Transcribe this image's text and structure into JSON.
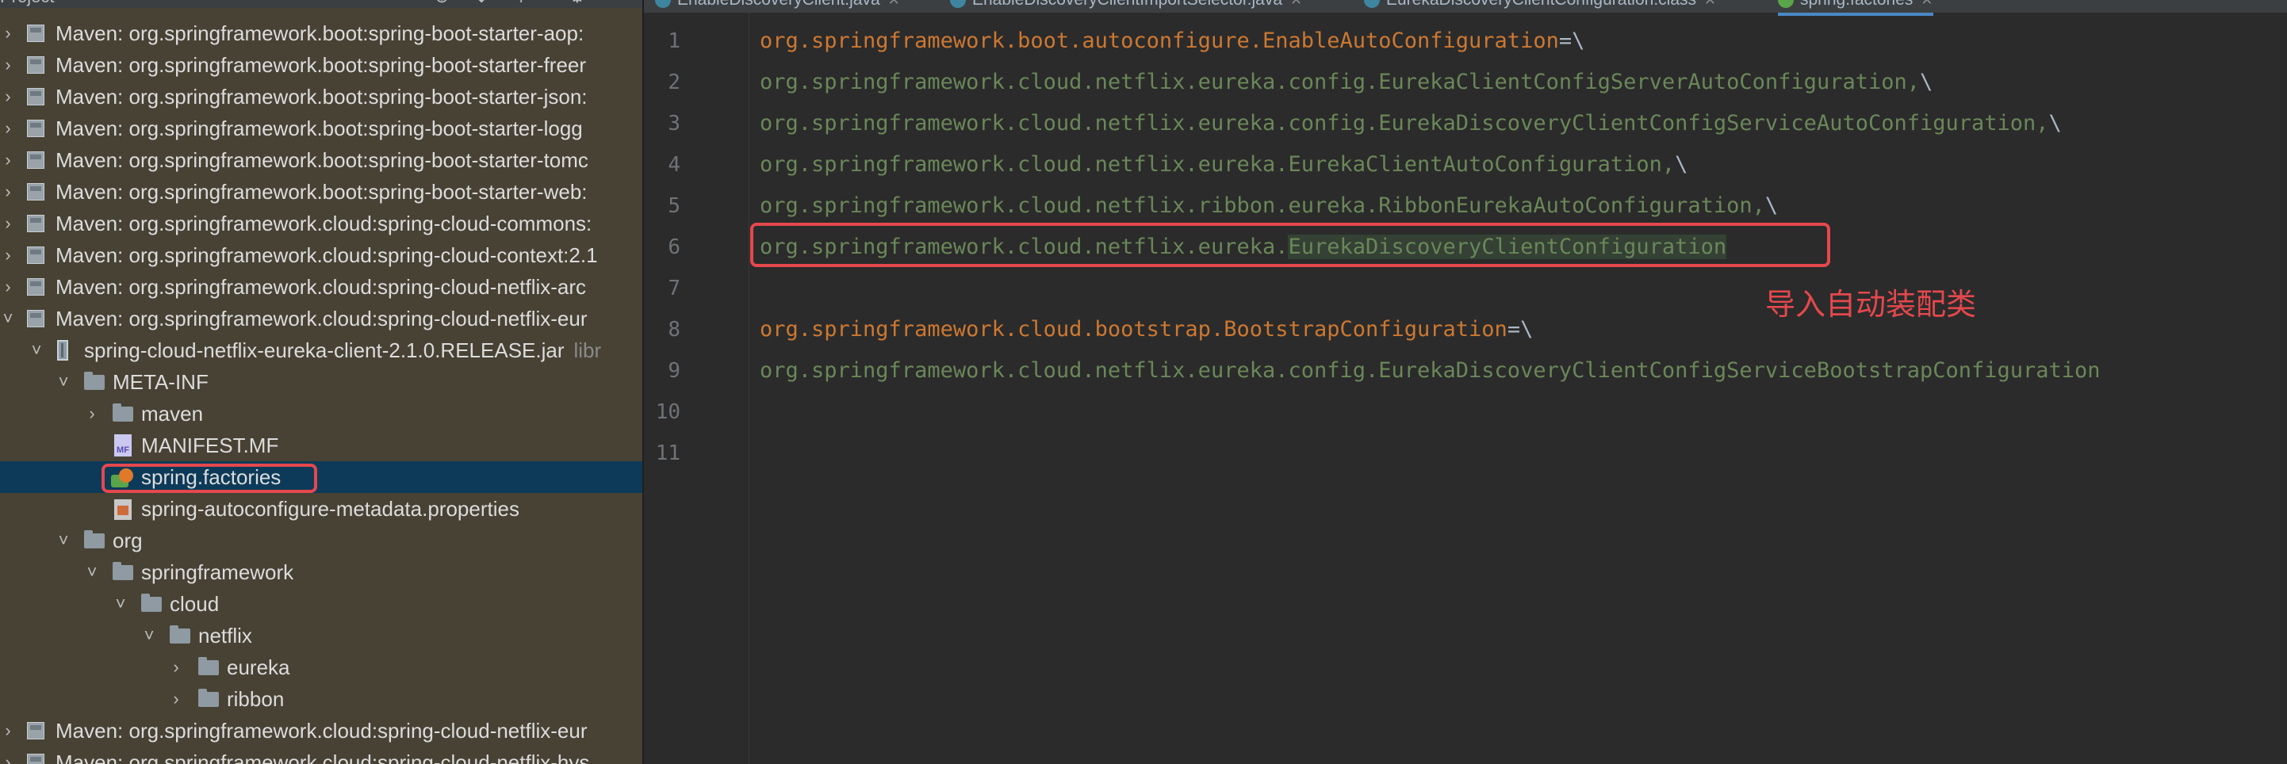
{
  "project_panel": {
    "title": "Project",
    "tree": [
      {
        "label": "Maven: org.springframework.boot:spring-boot-starter-aop:"
      },
      {
        "label": "Maven: org.springframework.boot:spring-boot-starter-freer"
      },
      {
        "label": "Maven: org.springframework.boot:spring-boot-starter-json:"
      },
      {
        "label": "Maven: org.springframework.boot:spring-boot-starter-logg"
      },
      {
        "label": "Maven: org.springframework.boot:spring-boot-starter-tomc"
      },
      {
        "label": "Maven: org.springframework.boot:spring-boot-starter-web:"
      },
      {
        "label": "Maven: org.springframework.cloud:spring-cloud-commons:"
      },
      {
        "label": "Maven: org.springframework.cloud:spring-cloud-context:2.1"
      },
      {
        "label": "Maven: org.springframework.cloud:spring-cloud-netflix-arc"
      },
      {
        "label": "Maven: org.springframework.cloud:spring-cloud-netflix-eur"
      },
      {
        "label": "spring-cloud-netflix-eureka-client-2.1.0.RELEASE.jar",
        "suffix": "libr"
      },
      {
        "label": "META-INF"
      },
      {
        "label": "maven"
      },
      {
        "label": "MANIFEST.MF"
      },
      {
        "label": "spring.factories"
      },
      {
        "label": "spring-autoconfigure-metadata.properties"
      },
      {
        "label": "org"
      },
      {
        "label": "springframework"
      },
      {
        "label": "cloud"
      },
      {
        "label": "netflix"
      },
      {
        "label": "eureka"
      },
      {
        "label": "ribbon"
      },
      {
        "label": "Maven: org.springframework.cloud:spring-cloud-netflix-eur"
      },
      {
        "label": "Maven: org.springframework.cloud:spring-cloud-netflix-hys"
      }
    ]
  },
  "tabs": [
    {
      "label": "EnableDiscoveryClient.java"
    },
    {
      "label": "EnableDiscoveryClientImportSelector.java"
    },
    {
      "label": "EurekaDiscoveryClientConfiguration.class"
    },
    {
      "label": "spring.factories"
    }
  ],
  "editor": {
    "line_numbers": [
      "1",
      "2",
      "3",
      "4",
      "5",
      "6",
      "7",
      "8",
      "9",
      "10",
      "11"
    ],
    "lines": [
      {
        "key": "org.springframework.boot.autoconfigure.EnableAutoConfiguration",
        "sep": "=\\"
      },
      {
        "value": "org.springframework.cloud.netflix.eureka.config.EurekaClientConfigServerAutoConfiguration,",
        "cont": "\\"
      },
      {
        "value": "org.springframework.cloud.netflix.eureka.config.EurekaDiscoveryClientConfigServiceAutoConfiguration,",
        "cont": "\\"
      },
      {
        "value": "org.springframework.cloud.netflix.eureka.EurekaClientAutoConfiguration,",
        "cont": "\\"
      },
      {
        "value": "org.springframework.cloud.netflix.ribbon.eureka.RibbonEurekaAutoConfiguration,",
        "cont": "\\"
      },
      {
        "value_prefix": "org.springframework.cloud.netflix.eureka.",
        "value_highlight": "EurekaDiscoveryClientConfiguration"
      },
      {},
      {
        "key": "org.springframework.cloud.bootstrap.BootstrapConfiguration",
        "sep": "=\\"
      },
      {
        "value": "org.springframework.cloud.netflix.eureka.config.EurekaDiscoveryClientConfigServiceBootstrapConfiguration"
      }
    ]
  },
  "annotation": "导入自动装配类",
  "colors": {
    "annotation": "#e5484d",
    "key": "#cc7832",
    "value": "#6a8759",
    "selection": "#0d3a58"
  }
}
